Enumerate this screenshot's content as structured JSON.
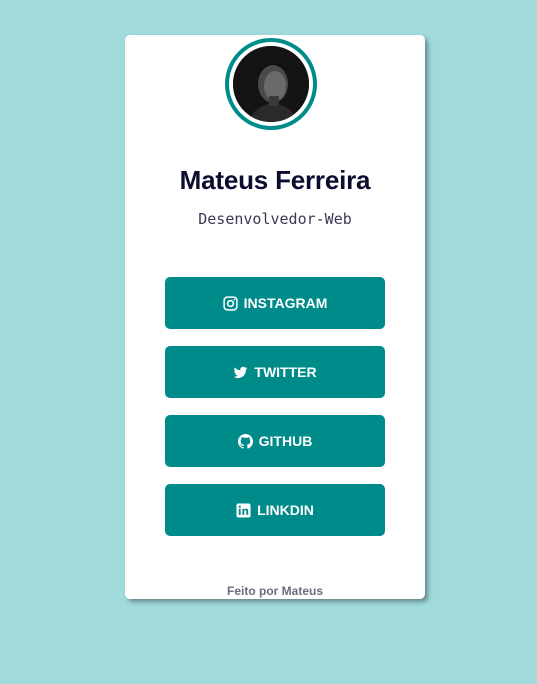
{
  "profile": {
    "name": "Mateus Ferreira",
    "role": "Desenvolvedor-Web",
    "avatar_icon": "profile-photo"
  },
  "links": {
    "instagram": {
      "label": "INSTAGRAM",
      "icon": "instagram-icon"
    },
    "twitter": {
      "label": "TWITTER",
      "icon": "twitter-icon"
    },
    "github": {
      "label": "GITHUB",
      "icon": "github-icon"
    },
    "linkedin": {
      "label": "LINKDIN",
      "icon": "linkedin-icon"
    }
  },
  "footer": {
    "text": "Feito por Mateus"
  },
  "colors": {
    "background": "#a0dadb",
    "card": "#ffffff",
    "accent": "#008b8b",
    "name": "#0c0c2e",
    "footer_text": "#6b6b7a"
  }
}
